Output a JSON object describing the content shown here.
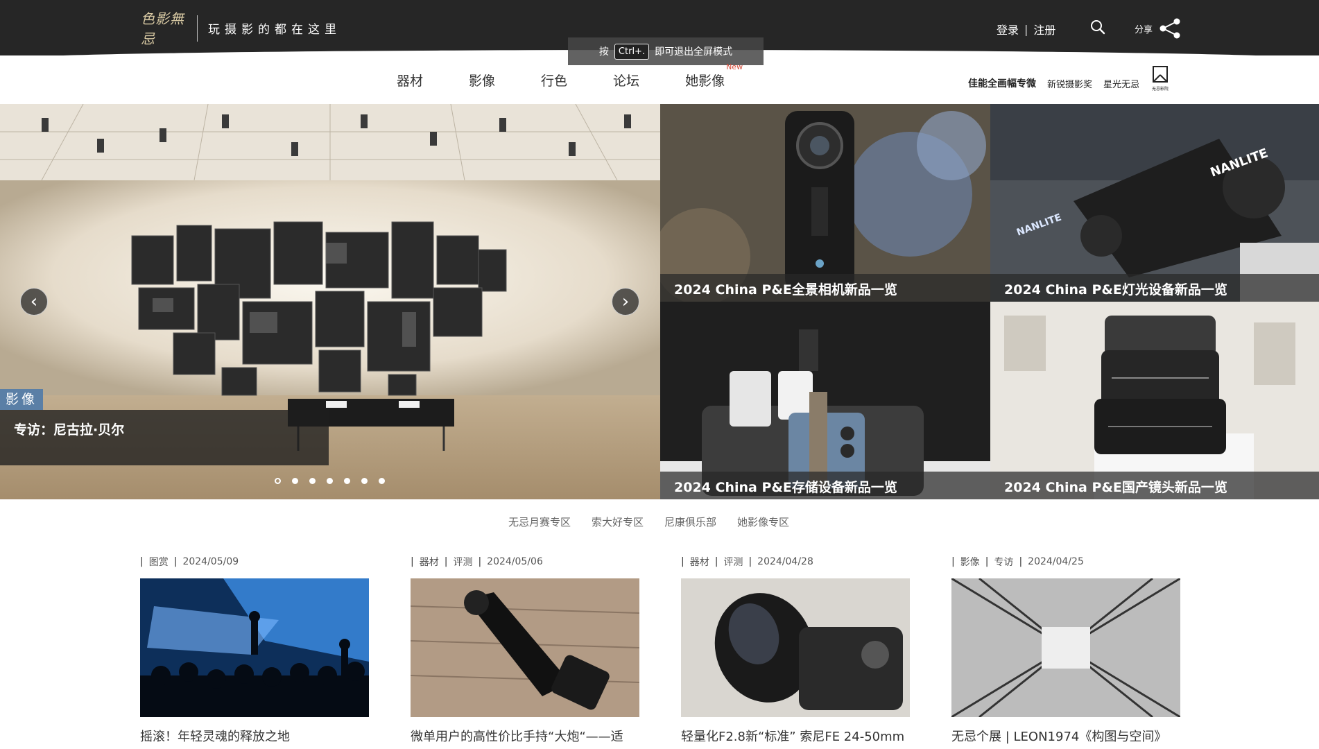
{
  "header": {
    "logo_text": "色影無忌",
    "slogan": "玩摄影的都在这里",
    "login": "登录",
    "sep": "|",
    "register": "注册",
    "share": "分享"
  },
  "fullscreen_tip": {
    "prefix": "按",
    "key": "Ctrl+.",
    "suffix": "即可退出全屏模式"
  },
  "nav": {
    "items": [
      "器材",
      "影像",
      "行色",
      "论坛",
      "她影像"
    ],
    "new_badge": "New"
  },
  "partners": {
    "items": [
      "佳能全画幅专微",
      "新锐摄影奖",
      "星光无忌"
    ],
    "logo_text": "无忌影院"
  },
  "hero": {
    "tag": "影像",
    "caption": "专访：尼古拉·贝尔",
    "slide_count": 7,
    "active_slide": 1
  },
  "tiles": [
    {
      "title": "2024 China P&E全景相机新品一览"
    },
    {
      "title": "2024 China P&E灯光设备新品一览"
    },
    {
      "title": "2024 China P&E存储设备新品一览"
    },
    {
      "title": "2024 China P&E国产镜头新品一览"
    }
  ],
  "sublinks": [
    "无忌月赛专区",
    "索大好专区",
    "尼康俱乐部",
    "她影像专区"
  ],
  "cards": [
    {
      "tags": [
        "图赏"
      ],
      "date": "2024/05/09",
      "title": "摇滚！年轻灵魂的释放之地"
    },
    {
      "tags": [
        "器材",
        "评测"
      ],
      "date": "2024/05/06",
      "title": "微单用户的高性价比手持“大炮“——适"
    },
    {
      "tags": [
        "器材",
        "评测"
      ],
      "date": "2024/04/28",
      "title": "轻量化F2.8新“标准” 索尼FE 24-50mm"
    },
    {
      "tags": [
        "影像",
        "专访"
      ],
      "date": "2024/04/25",
      "title": "无忌个展 | LEON1974《构图与空间》"
    }
  ],
  "colors": {
    "topbar": "#262626",
    "hero_tag": "#5a7fa6",
    "new_badge": "#d34b3a"
  }
}
